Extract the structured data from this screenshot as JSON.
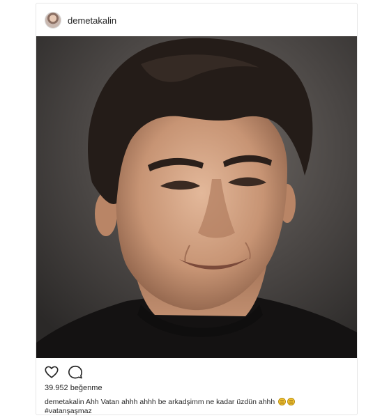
{
  "post": {
    "username": "demetakalin",
    "likes": "39.952 beğenme",
    "caption": {
      "author": "demetakalin",
      "text": " Ahh Vatan ahhh ahhh be arkadşimm ne kadar üzdün ahhh",
      "emojis": [
        "sad-face-icon",
        "sad-face-icon"
      ],
      "hashtag": "#vatanşaşmaz"
    }
  },
  "icons": {
    "like": "heart-outline-icon",
    "comment": "speech-bubble-icon"
  },
  "colors": {
    "text": "#262626",
    "border": "#e6e6e6",
    "photo_background": "#3a3838",
    "shirt": "#141212"
  }
}
